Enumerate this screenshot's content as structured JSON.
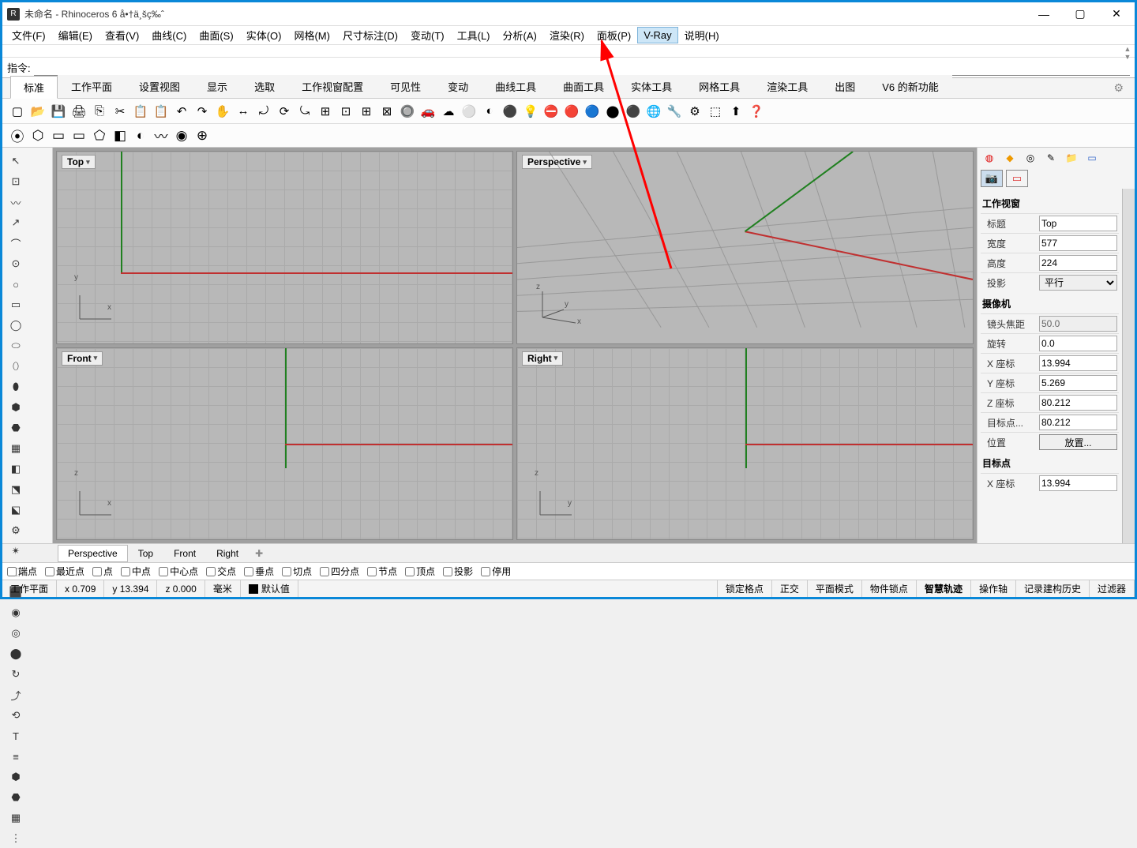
{
  "title": "未命名 - Rhinoceros 6 å•†ä¸šç‰ˆ",
  "menu": [
    "文件(F)",
    "编辑(E)",
    "查看(V)",
    "曲线(C)",
    "曲面(S)",
    "实体(O)",
    "网格(M)",
    "尺寸标注(D)",
    "变动(T)",
    "工具(L)",
    "分析(A)",
    "渲染(R)",
    "面板(P)",
    "V-Ray",
    "说明(H)"
  ],
  "menu_highlight_index": 13,
  "cmd_history_hint": "",
  "cmd_label": "指令:",
  "tool_tabs": [
    "标准",
    "工作平面",
    "设置视图",
    "显示",
    "选取",
    "工作视窗配置",
    "可见性",
    "变动",
    "曲线工具",
    "曲面工具",
    "实体工具",
    "网格工具",
    "渲染工具",
    "出图",
    "V6 的新功能"
  ],
  "active_tool_tab": 0,
  "viewports": {
    "tl": "Top",
    "tr": "Perspective",
    "bl": "Front",
    "br": "Right"
  },
  "vp_tabs": [
    "Perspective",
    "Top",
    "Front",
    "Right"
  ],
  "vp_tabs_active": 0,
  "right": {
    "section1": "工作视窗",
    "rows1": [
      {
        "k": "标题",
        "v": "Top",
        "t": "input"
      },
      {
        "k": "宽度",
        "v": "577",
        "t": "input"
      },
      {
        "k": "高度",
        "v": "224",
        "t": "input"
      },
      {
        "k": "投影",
        "v": "平行",
        "t": "select"
      }
    ],
    "section2": "摄像机",
    "rows2": [
      {
        "k": "镜头焦距",
        "v": "50.0",
        "t": "ro"
      },
      {
        "k": "旋转",
        "v": "0.0",
        "t": "input"
      },
      {
        "k": "X 座标",
        "v": "13.994",
        "t": "input"
      },
      {
        "k": "Y 座标",
        "v": "5.269",
        "t": "input"
      },
      {
        "k": "Z 座标",
        "v": "80.212",
        "t": "input"
      },
      {
        "k": "目标点...",
        "v": "80.212",
        "t": "input"
      },
      {
        "k": "位置",
        "v": "放置...",
        "t": "button"
      }
    ],
    "section3": "目标点",
    "rows3": [
      {
        "k": "X 座标",
        "v": "13.994",
        "t": "input"
      }
    ]
  },
  "osnap": [
    "端点",
    "最近点",
    "点",
    "中点",
    "中心点",
    "交点",
    "垂点",
    "切点",
    "四分点",
    "节点",
    "顶点",
    "投影",
    "停用"
  ],
  "status": {
    "cplane": "工作平面",
    "x": "x 0.709",
    "y": "y 13.394",
    "z": "z 0.000",
    "unit": "毫米",
    "layer": "默认值",
    "toggles": [
      "锁定格点",
      "正交",
      "平面模式",
      "物件锁点",
      "智慧轨迹",
      "操作轴",
      "记录建构历史",
      "过滤器"
    ],
    "bold_index": 4
  }
}
